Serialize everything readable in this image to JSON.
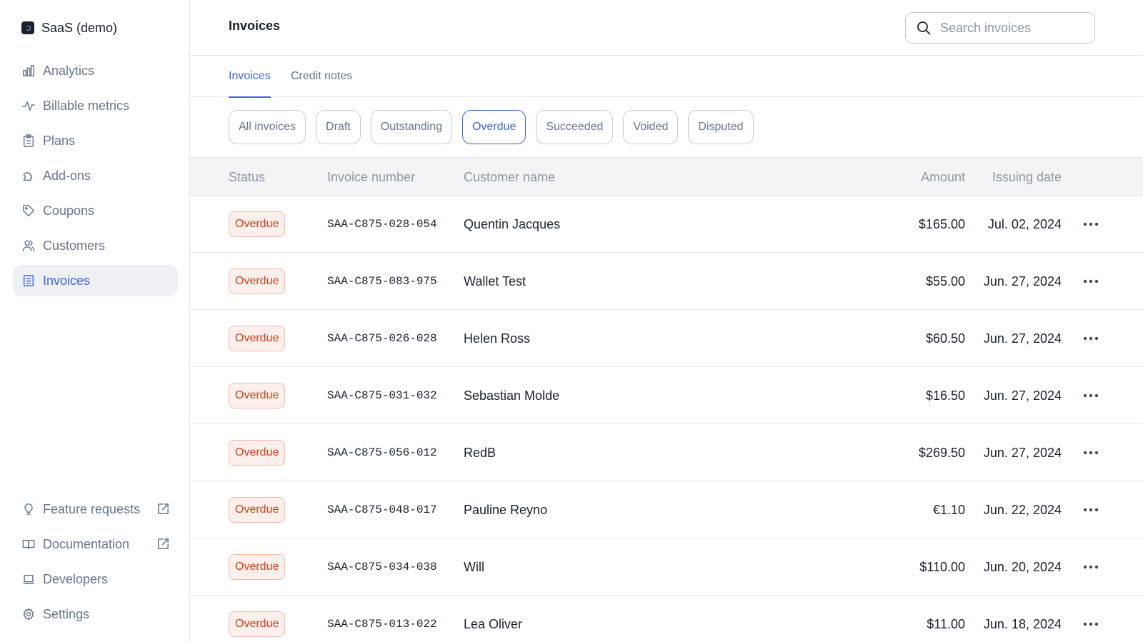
{
  "sidebar": {
    "org_name": "SaaS (demo)",
    "top_items": [
      {
        "label": "Analytics",
        "icon": "bar-chart-icon"
      },
      {
        "label": "Billable metrics",
        "icon": "pulse-icon"
      },
      {
        "label": "Plans",
        "icon": "clipboard-icon"
      },
      {
        "label": "Add-ons",
        "icon": "puzzle-icon"
      },
      {
        "label": "Coupons",
        "icon": "tag-icon"
      },
      {
        "label": "Customers",
        "icon": "users-icon"
      },
      {
        "label": "Invoices",
        "icon": "document-icon",
        "active": true
      }
    ],
    "bottom_items": [
      {
        "label": "Feature requests",
        "icon": "lightbulb-icon",
        "external": true
      },
      {
        "label": "Documentation",
        "icon": "book-icon",
        "external": true
      },
      {
        "label": "Developers",
        "icon": "laptop-icon"
      },
      {
        "label": "Settings",
        "icon": "gear-icon"
      }
    ]
  },
  "header": {
    "title": "Invoices",
    "search_placeholder": "Search invoices"
  },
  "tabs": [
    {
      "label": "Invoices",
      "active": true
    },
    {
      "label": "Credit notes",
      "active": false
    }
  ],
  "filters": [
    {
      "label": "All invoices",
      "active": false
    },
    {
      "label": "Draft",
      "active": false
    },
    {
      "label": "Outstanding",
      "active": false
    },
    {
      "label": "Overdue",
      "active": true
    },
    {
      "label": "Succeeded",
      "active": false
    },
    {
      "label": "Voided",
      "active": false
    },
    {
      "label": "Disputed",
      "active": false
    }
  ],
  "table": {
    "columns": {
      "status": "Status",
      "number": "Invoice number",
      "customer": "Customer name",
      "amount": "Amount",
      "date": "Issuing date"
    },
    "rows": [
      {
        "status": "Overdue",
        "number": "SAA-C875-028-054",
        "customer": "Quentin Jacques",
        "amount": "$165.00",
        "date": "Jul. 02, 2024"
      },
      {
        "status": "Overdue",
        "number": "SAA-C875-083-975",
        "customer": "Wallet Test",
        "amount": "$55.00",
        "date": "Jun. 27, 2024"
      },
      {
        "status": "Overdue",
        "number": "SAA-C875-026-028",
        "customer": "Helen Ross",
        "amount": "$60.50",
        "date": "Jun. 27, 2024"
      },
      {
        "status": "Overdue",
        "number": "SAA-C875-031-032",
        "customer": "Sebastian Molde",
        "amount": "$16.50",
        "date": "Jun. 27, 2024"
      },
      {
        "status": "Overdue",
        "number": "SAA-C875-056-012",
        "customer": "RedB",
        "amount": "$269.50",
        "date": "Jun. 27, 2024"
      },
      {
        "status": "Overdue",
        "number": "SAA-C875-048-017",
        "customer": "Pauline Reyno",
        "amount": "€1.10",
        "date": "Jun. 22, 2024"
      },
      {
        "status": "Overdue",
        "number": "SAA-C875-034-038",
        "customer": "Will",
        "amount": "$110.00",
        "date": "Jun. 20, 2024"
      },
      {
        "status": "Overdue",
        "number": "SAA-C875-013-022",
        "customer": "Lea Oliver",
        "amount": "$11.00",
        "date": "Jun. 18, 2024"
      }
    ]
  },
  "colors": {
    "accent": "#3e63dd",
    "overdue_text": "#d13f19",
    "overdue_bg": "#fdf0ec",
    "muted_text": "#66758a"
  }
}
